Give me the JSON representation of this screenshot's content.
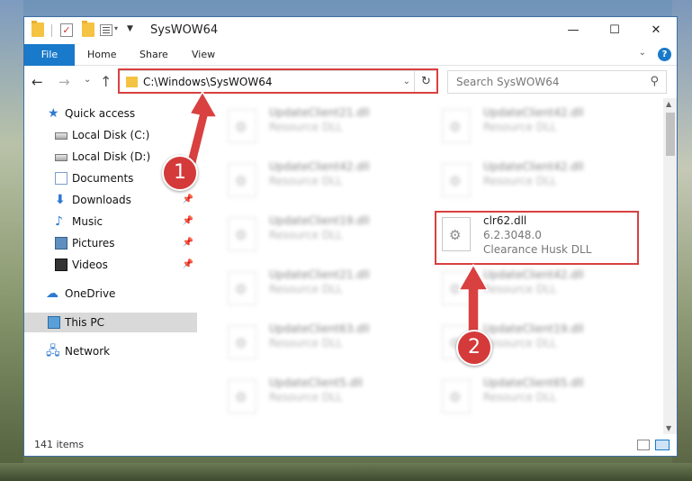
{
  "window": {
    "title": "SysWOW64"
  },
  "ribbon": {
    "tabs": [
      "File",
      "Home",
      "Share",
      "View"
    ],
    "help": "?"
  },
  "window_buttons": {
    "minimize": "—",
    "maximize": "☐",
    "close": "✕"
  },
  "address": {
    "path": "C:\\Windows\\SysWOW64",
    "refresh": "↻"
  },
  "search": {
    "placeholder": "Search SysWOW64",
    "icon": "search-icon"
  },
  "sidebar": {
    "items": [
      {
        "label": "Quick access",
        "icon": "star-icon"
      },
      {
        "label": "Local Disk (C:)",
        "icon": "disk-icon"
      },
      {
        "label": "Local Disk (D:)",
        "icon": "disk-icon"
      },
      {
        "label": "Documents",
        "icon": "documents-icon"
      },
      {
        "label": "Downloads",
        "icon": "download-icon",
        "pinned": true
      },
      {
        "label": "Music",
        "icon": "music-icon",
        "pinned": true
      },
      {
        "label": "Pictures",
        "icon": "pictures-icon",
        "pinned": true
      },
      {
        "label": "Videos",
        "icon": "videos-icon",
        "pinned": true
      },
      {
        "label": "OneDrive",
        "icon": "cloud-icon"
      },
      {
        "label": "This PC",
        "icon": "computer-icon",
        "selected": true
      },
      {
        "label": "Network",
        "icon": "network-icon"
      }
    ]
  },
  "files": {
    "left": [
      {
        "name": "UpdateClient21.dll",
        "desc": "Resource DLL"
      },
      {
        "name": "UpdateClient42.dll",
        "desc": "Resource DLL"
      },
      {
        "name": "UpdateClient19.dll",
        "desc": "Resource DLL"
      },
      {
        "name": "UpdateClient21.dll",
        "desc": "Resource DLL"
      },
      {
        "name": "UpdateClient63.dll",
        "desc": "Resource DLL"
      },
      {
        "name": "UpdateClient5.dll",
        "desc": "Resource DLL"
      }
    ],
    "right": [
      {
        "name": "UpdateClient42.dll",
        "desc": "Resource DLL"
      },
      {
        "name": "UpdateClient42.dll",
        "desc": "Resource DLL"
      },
      {
        "name": "UpdateClient42.dll",
        "desc": "Resource DLL"
      },
      {
        "name": "UpdateClient19.dll",
        "desc": "Resource DLL"
      },
      {
        "name": "UpdateClient65.dll",
        "desc": "Resource DLL"
      }
    ],
    "highlighted": {
      "name": "clr62.dll",
      "version": "6.2.3048.0",
      "desc": "Clearance Husk DLL"
    }
  },
  "status": {
    "items": "141 items"
  },
  "annotations": {
    "step1": "1",
    "step2": "2",
    "color": "#d94040"
  }
}
